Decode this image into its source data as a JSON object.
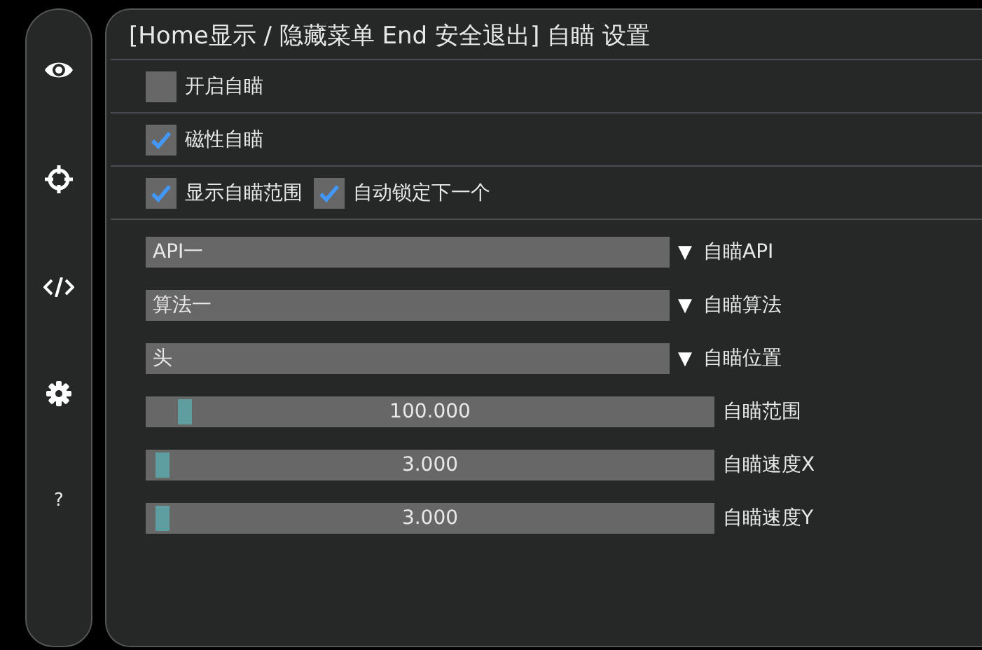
{
  "sidebar": {
    "items": [
      {
        "kind": "eye"
      },
      {
        "kind": "crosshair"
      },
      {
        "kind": "code"
      },
      {
        "kind": "gear"
      },
      {
        "kind": "text",
        "label": "?"
      }
    ]
  },
  "panel": {
    "title": "[Home显示 / 隐藏菜单  End 安全退出] 自瞄 设置",
    "rows": [
      {
        "kind": "checks",
        "items": [
          {
            "label": "开启自瞄",
            "checked": false
          }
        ]
      },
      {
        "kind": "checks",
        "items": [
          {
            "label": "磁性自瞄",
            "checked": true
          }
        ]
      },
      {
        "kind": "checks",
        "items": [
          {
            "label": "显示自瞄范围",
            "checked": true
          },
          {
            "label": "自动锁定下一个",
            "checked": true
          }
        ]
      },
      {
        "kind": "dropdown",
        "value": "API一",
        "arrow": "▼",
        "label": "自瞄API"
      },
      {
        "kind": "dropdown",
        "value": "算法一",
        "arrow": "▼",
        "label": "自瞄算法"
      },
      {
        "kind": "dropdown",
        "value": "头",
        "arrow": "▼",
        "label": "自瞄位置"
      },
      {
        "kind": "slider",
        "value": "100.000",
        "level": 0.05,
        "label": "自瞄范围"
      },
      {
        "kind": "slider",
        "value": "3.000",
        "level": 0.01,
        "label": "自瞄速度X"
      },
      {
        "kind": "slider",
        "value": "3.000",
        "level": 0.01,
        "label": "自瞄速度Y"
      }
    ]
  }
}
